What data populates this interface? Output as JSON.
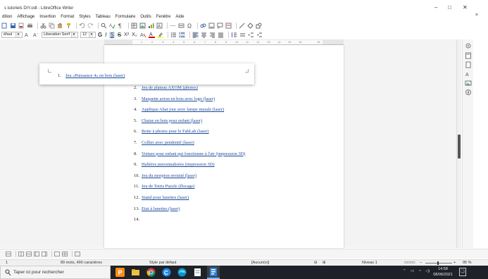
{
  "window": {
    "title": "s tutoriels DIY.odt - LibreOffice Writer",
    "minimize": "–",
    "maximize": "□",
    "close": "✕"
  },
  "menubar": {
    "items": [
      "dition",
      "Affichage",
      "Insertion",
      "Format",
      "Styles",
      "Tableau",
      "Formulaire",
      "Outils",
      "Fenêtre",
      "Aide"
    ],
    "close_doc": "×"
  },
  "toolbar2": {
    "style_value": "éfaut",
    "font_value": "Liberation Serif",
    "size_value": "12"
  },
  "ruler": {
    "ticks": [
      "1",
      "2",
      "3",
      "4",
      "5",
      "6",
      "7",
      "8",
      "9",
      "10",
      "11",
      "12",
      "13",
      "14",
      "15",
      "16",
      "18"
    ]
  },
  "document": {
    "list": [
      {
        "num": "1.",
        "text": "Jeu «Puissance 4» en bois (laser)"
      },
      {
        "num": "2.",
        "text": "Jeu de plateau AXOM (photos)"
      },
      {
        "num": "3.",
        "text": "Maquette avion en bois avec logo (laser)"
      },
      {
        "num": "4.",
        "text": "Applique Abat jour avec lampe murale (laser)"
      },
      {
        "num": "5.",
        "text": "Chaise en bois pour enfant (laser)"
      },
      {
        "num": "6.",
        "text": "Boite à photos pour le FabLab (laser)"
      },
      {
        "num": "7.",
        "text": "Collier avec pendentif (laser)"
      },
      {
        "num": "8.",
        "text": "Voiture pour enfant qui fonctionne à l'air (impression 3D)"
      },
      {
        "num": "9.",
        "text": "Haltères personnalisées (impression 3D)"
      },
      {
        "num": "10.",
        "text": "Jeu du morpion revisité (laser)"
      },
      {
        "num": "11.",
        "text": "Jeu de Tetris Puzzle (flocage)"
      },
      {
        "num": "12.",
        "text": "Stand pour lunettes (laser)"
      },
      {
        "num": "13.",
        "text": "Etui à lunettes (laser)"
      },
      {
        "num": "14.",
        "text": ""
      }
    ]
  },
  "statusbar": {
    "page": "1",
    "words": "89 mots, 490 caractères",
    "page_style": "Style par défaut",
    "language": "[Aucun(e)]",
    "level": "Niveau 1",
    "zoom": "95 %"
  },
  "taskbar": {
    "search_placeholder": "Taper ici pour rechercher",
    "time": "14:58",
    "date": "08/06/2021"
  },
  "colors": {
    "link": "#1a4a9a",
    "taskbar": "#1e2127",
    "accent_bullet": "#ff8800"
  }
}
